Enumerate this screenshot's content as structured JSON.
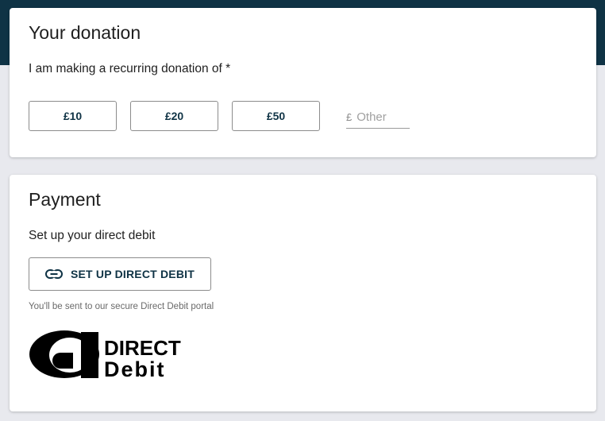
{
  "donation": {
    "title": "Your donation",
    "prompt": "I am making a recurring donation of *",
    "amounts": [
      "£10",
      "£20",
      "£50"
    ],
    "other": {
      "currency": "£",
      "placeholder": "Other",
      "value": ""
    }
  },
  "payment": {
    "title": "Payment",
    "prompt": "Set up your direct debit",
    "button_label": "SET UP DIRECT DEBIT",
    "button_icon": "link-icon",
    "note": "You'll be sent to our secure Direct Debit portal",
    "logo": {
      "line1": "DIRECT",
      "line2": "Debit"
    }
  },
  "colors": {
    "header_band": "#0f3345",
    "accent_text": "#0f3345",
    "page_background": "#e8e9ee"
  }
}
